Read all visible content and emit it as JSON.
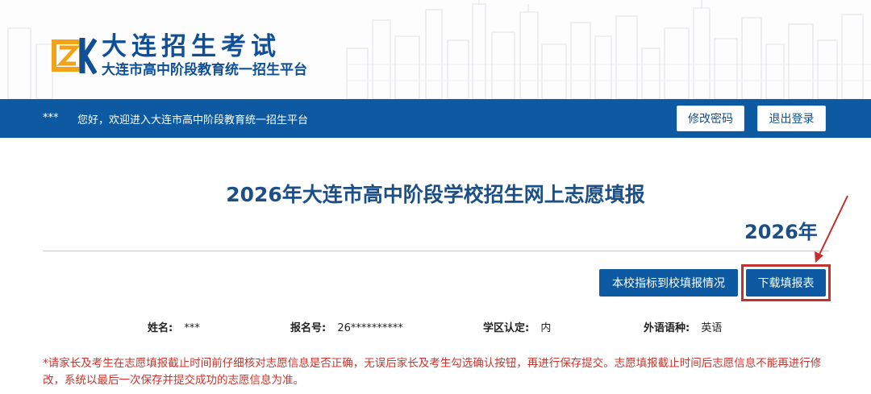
{
  "header": {
    "logo_title": "大连招生考试",
    "logo_subtitle": "大连市高中阶段教育统一招生平台"
  },
  "navbar": {
    "user": "***",
    "welcome": "您好，欢迎进入大连市高中阶段教育统一招生平台",
    "change_password": "修改密码",
    "logout": "退出登录"
  },
  "main": {
    "title": "2026年大连市高中阶段学校招生网上志愿填报",
    "year": "2026年",
    "quota_button": "本校指标到校填报情况",
    "download_button": "下载填报表"
  },
  "student": {
    "name_label": "姓名:",
    "name_value": "***",
    "regno_label": "报名号:",
    "regno_value": "26**********",
    "district_label": "学区认定:",
    "district_value": "内",
    "language_label": "外语语种:",
    "language_value": "英语"
  },
  "notice": "*请家长及考生在志愿填报截止时间前仔细核对志愿信息是否正确，无误后家长及考生勾选确认按钮，再进行保存提交。志愿填报截止时间后志愿信息不能再进行修改，系统以最后一次保存并提交成功的志愿信息为准。",
  "colors": {
    "brand_blue": "#0d5aa2",
    "title_blue": "#1b4f86",
    "notice_red": "#c9342c",
    "highlight_red": "#c0312f",
    "logo_orange": "#f2a418"
  }
}
